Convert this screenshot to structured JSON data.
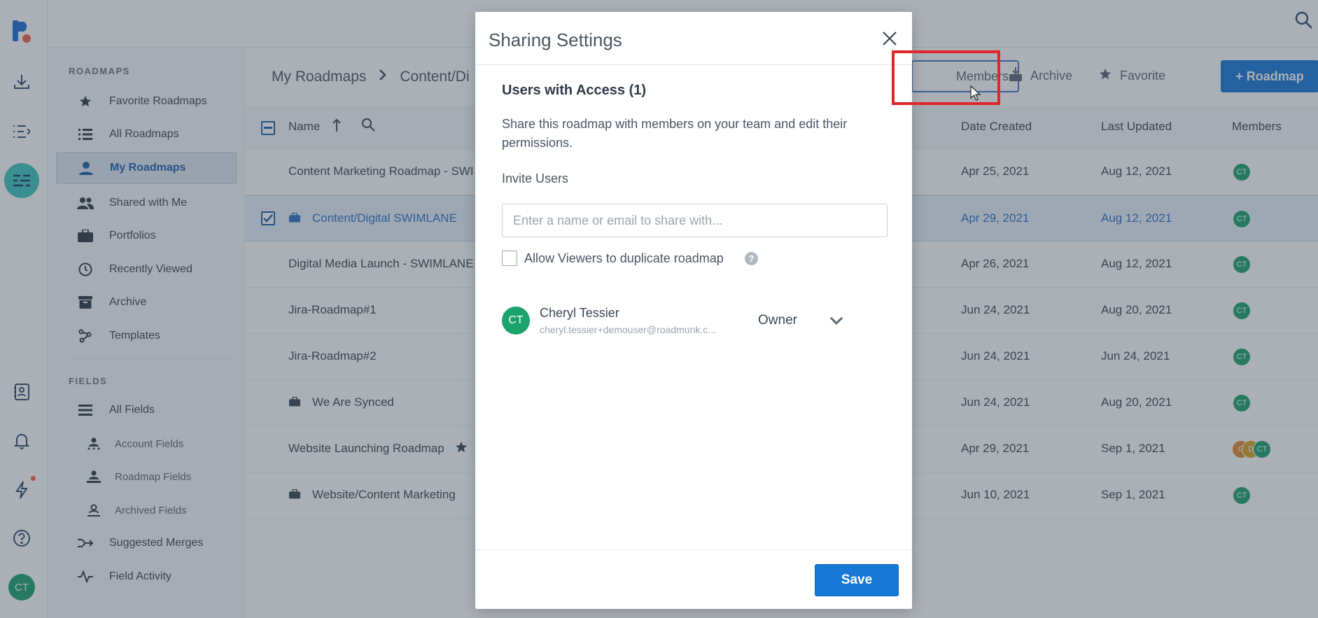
{
  "rail": {
    "avatar_initials": "CT",
    "icons": [
      "roadmunk-logo-icon",
      "download-icon",
      "list-icon",
      "roadmaps-icon",
      "contacts-icon",
      "bell-icon",
      "lightning-icon",
      "help-icon"
    ]
  },
  "sidebar": {
    "roadmaps_heading": "ROADMAPS",
    "roadmaps": [
      {
        "label": "Favorite Roadmaps",
        "icon": "star-icon"
      },
      {
        "label": "All Roadmaps",
        "icon": "list-icon"
      },
      {
        "label": "My Roadmaps",
        "icon": "person-icon",
        "active": true
      },
      {
        "label": "Shared with Me",
        "icon": "people-icon"
      },
      {
        "label": "Portfolios",
        "icon": "briefcase-icon"
      },
      {
        "label": "Recently Viewed",
        "icon": "clock-icon"
      },
      {
        "label": "Archive",
        "icon": "archive-icon"
      },
      {
        "label": "Templates",
        "icon": "templates-icon"
      }
    ],
    "fields_heading": "FIELDS",
    "fields": [
      {
        "label": "All Fields",
        "icon": "lines-icon"
      },
      {
        "label": "Account Fields",
        "icon": "account-fields-icon",
        "sub": true
      },
      {
        "label": "Roadmap Fields",
        "icon": "roadmap-fields-icon",
        "sub": true
      },
      {
        "label": "Archived Fields",
        "icon": "archived-fields-icon",
        "sub": true
      },
      {
        "label": "Suggested Merges",
        "icon": "merge-icon"
      },
      {
        "label": "Field Activity",
        "icon": "activity-icon"
      }
    ]
  },
  "main": {
    "breadcrumb": [
      "My Roadmaps",
      "Content/Di"
    ],
    "toolbar": {
      "members": "Members",
      "archive": "Archive",
      "favorite": "Favorite",
      "new_roadmap": "+ Roadmap"
    },
    "columns": {
      "name": "Name",
      "date_created": "Date Created",
      "last_updated": "Last Updated",
      "members": "Members"
    },
    "rows": [
      {
        "name": "Content Marketing Roadmap - SWI",
        "created": "Apr 25, 2021",
        "updated": "Aug 12, 2021",
        "members": [
          "CT"
        ]
      },
      {
        "name": "Content/Digital SWIMLANE",
        "created": "Apr 29, 2021",
        "updated": "Aug 12, 2021",
        "members": [
          "CT"
        ],
        "selected": true,
        "portfolio": true
      },
      {
        "name": "Digital Media Launch - SWIMLANE",
        "created": "Apr 26, 2021",
        "updated": "Aug 12, 2021",
        "members": [
          "CT"
        ]
      },
      {
        "name": "Jira-Roadmap#1",
        "created": "Jun 24, 2021",
        "updated": "Aug 20, 2021",
        "members": [
          "CT"
        ]
      },
      {
        "name": "Jira-Roadmap#2",
        "created": "Jun 24, 2021",
        "updated": "Jun 24, 2021",
        "members": [
          "CT"
        ]
      },
      {
        "name": "We Are Synced",
        "created": "Jun 24, 2021",
        "updated": "Aug 20, 2021",
        "members": [
          "CT"
        ],
        "portfolio": true
      },
      {
        "name": "Website Launching Roadmap",
        "created": "Apr 29, 2021",
        "updated": "Sep 1, 2021",
        "members": [
          "G",
          "D",
          "CT"
        ],
        "favorite": true
      },
      {
        "name": "Website/Content Marketing",
        "created": "Jun 10, 2021",
        "updated": "Sep 1, 2021",
        "members": [
          "CT"
        ],
        "portfolio": true
      }
    ]
  },
  "modal": {
    "title": "Sharing Settings",
    "users_heading": "Users with Access (1)",
    "description": "Share this roadmap with members on your team and edit their permissions.",
    "invite_label": "Invite Users",
    "invite_placeholder": "Enter a name or email to share with...",
    "allow_duplicate_label": "Allow Viewers to duplicate roadmap",
    "user": {
      "initials": "CT",
      "name": "Cheryl Tessier",
      "email": "cheryl.tessier+demouser@roadmunk.c...",
      "role": "Owner"
    },
    "save_label": "Save"
  },
  "colors": {
    "accent": "#1878d6",
    "avatar_green": "#1aa36b",
    "teal": "#3ec7bd",
    "highlight_red": "#e0262a"
  }
}
